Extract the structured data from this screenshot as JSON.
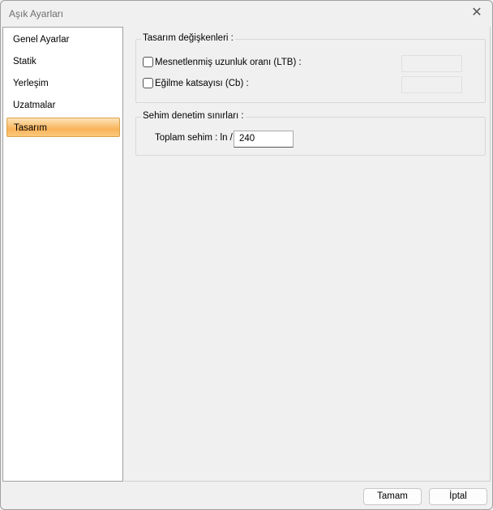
{
  "window": {
    "title": "Aşık Ayarları"
  },
  "sidebar": {
    "items": [
      {
        "label": "Genel Ayarlar"
      },
      {
        "label": "Statik"
      },
      {
        "label": "Yerleşim"
      },
      {
        "label": "Uzatmalar"
      },
      {
        "label": "Tasarım",
        "selected": true
      }
    ]
  },
  "design_vars": {
    "title": "Tasarım değişkenleri :",
    "ltb_label": "Mesnetlenmiş uzunluk oranı (LTB) :",
    "ltb_checked": false,
    "ltb_value": "",
    "cb_label": "Eğilme katsayısı (Cb) :",
    "cb_checked": false,
    "cb_value": ""
  },
  "deflection": {
    "title": "Sehim denetim sınırları :",
    "total_label": "Toplam sehim : ln /",
    "total_value": "240"
  },
  "footer": {
    "ok": "Tamam",
    "cancel": "İptal"
  },
  "colors": {
    "selected": "#f9b35a"
  }
}
